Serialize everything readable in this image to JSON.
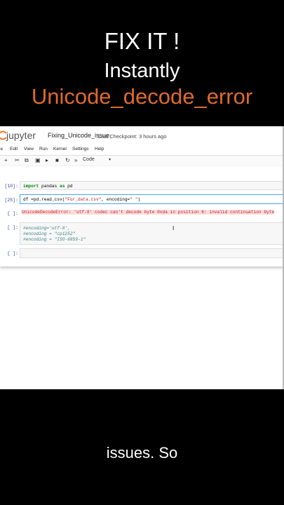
{
  "headline": {
    "line1": "FIX IT !",
    "line2": "Instantly",
    "line3": "Unicode_decode_error"
  },
  "colors": {
    "accent": "#e0692a",
    "prompt_in": "#303f9f",
    "prompt_out": "#d84315",
    "jupyter_orange": "#f37726"
  },
  "jupyter": {
    "brand": "jupyter",
    "notebook_name": "Fixing_Unicode_issue",
    "checkpoint": "Last Checkpoint: 3 hours ago",
    "menu": [
      "File",
      "Edit",
      "View",
      "Run",
      "Kernel",
      "Settings",
      "Help"
    ],
    "menu_visible": [
      "le",
      "Edit",
      "View",
      "Run",
      "Kernel",
      "Settings",
      "Help"
    ],
    "toolbar_icons": [
      "plus-icon",
      "cut-icon",
      "copy-icon",
      "paste-icon",
      "run-icon",
      "stop-icon",
      "restart-icon",
      "fast-forward-icon"
    ],
    "cell_type": "Code"
  },
  "cells": [
    {
      "prompt": "[10]:",
      "code": "import pandas as pd"
    },
    {
      "prompt": "[25]:",
      "code": "df =pd.read_csv(\"Fur_data.csv\", encoding=\" \")"
    },
    {
      "prompt": "[ ]:",
      "error_name": "UnicodeDecodeError",
      "error_msg": ": 'utf-8' codec can't decode byte 0xda in position 6: invalid continuation byte"
    },
    {
      "prompt": "[ ]:",
      "lines": [
        "#encoding='utf-8',",
        "#encoding = \"cp1252\"",
        "#encoding = \"ISO-8859-1\""
      ]
    },
    {
      "prompt": "[ ]:"
    }
  ],
  "caption": "issues. So"
}
